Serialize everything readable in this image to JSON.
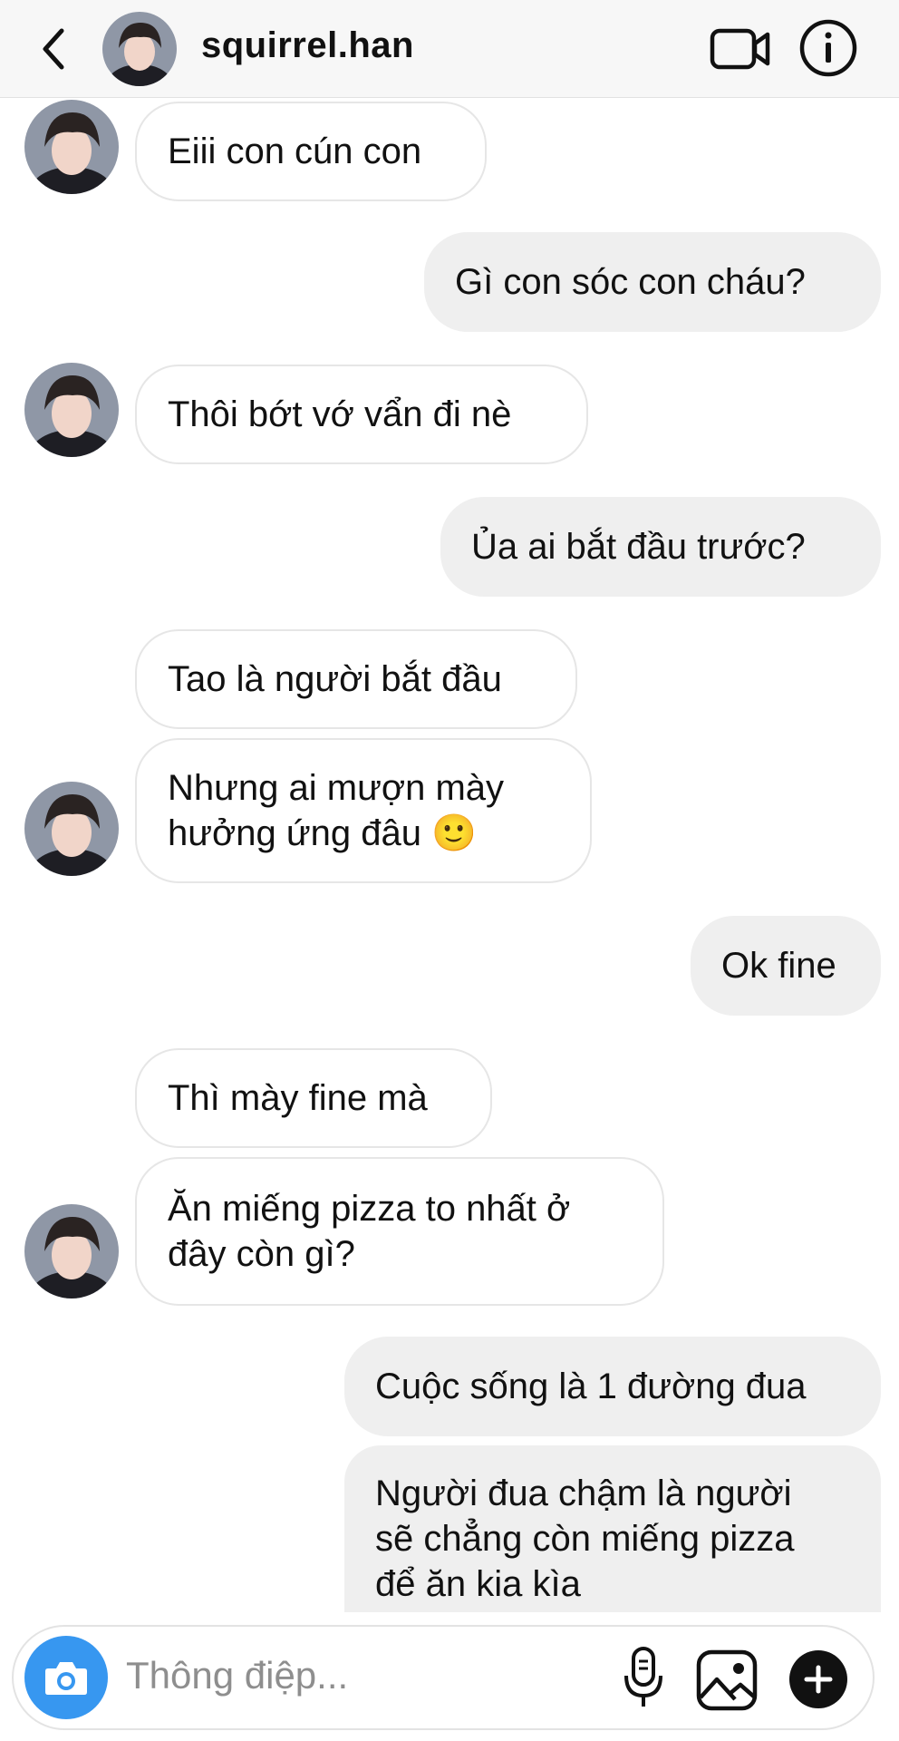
{
  "header": {
    "username": "squirrel.han"
  },
  "messages": [
    {
      "side": "in",
      "text": "Eiii con cún con"
    },
    {
      "side": "out",
      "text": "Gì con sóc con cháu?"
    },
    {
      "side": "in",
      "text": "Thôi bớt vớ vẩn đi nè"
    },
    {
      "side": "out",
      "text": "Ủa ai bắt đầu trước?"
    },
    {
      "side": "in",
      "text": "Tao là người bắt đầu"
    },
    {
      "side": "in",
      "text": "Nhưng ai mượn mày\nhưởng ứng đâu 🙂"
    },
    {
      "side": "out",
      "text": "Ok fine"
    },
    {
      "side": "in",
      "text": "Thì mày fine mà"
    },
    {
      "side": "in",
      "text": "Ăn miếng pizza to nhất ở\nđây còn gì?"
    },
    {
      "side": "out",
      "text": "Cuộc sống là 1 đường đua"
    },
    {
      "side": "out",
      "text": "Người đua chậm là người\nsẽ chẳng còn miếng pizza\nđể ăn kia kìa"
    }
  ],
  "composer": {
    "placeholder": "Thông điệp..."
  },
  "colors": {
    "accent": "#3797f0",
    "incoming_bg": "#ffffff",
    "outgoing_bg": "#efefef"
  },
  "icons": [
    "back-chevron-icon",
    "video-call-icon",
    "info-icon",
    "camera-icon",
    "microphone-icon",
    "gallery-icon",
    "plus-icon"
  ]
}
